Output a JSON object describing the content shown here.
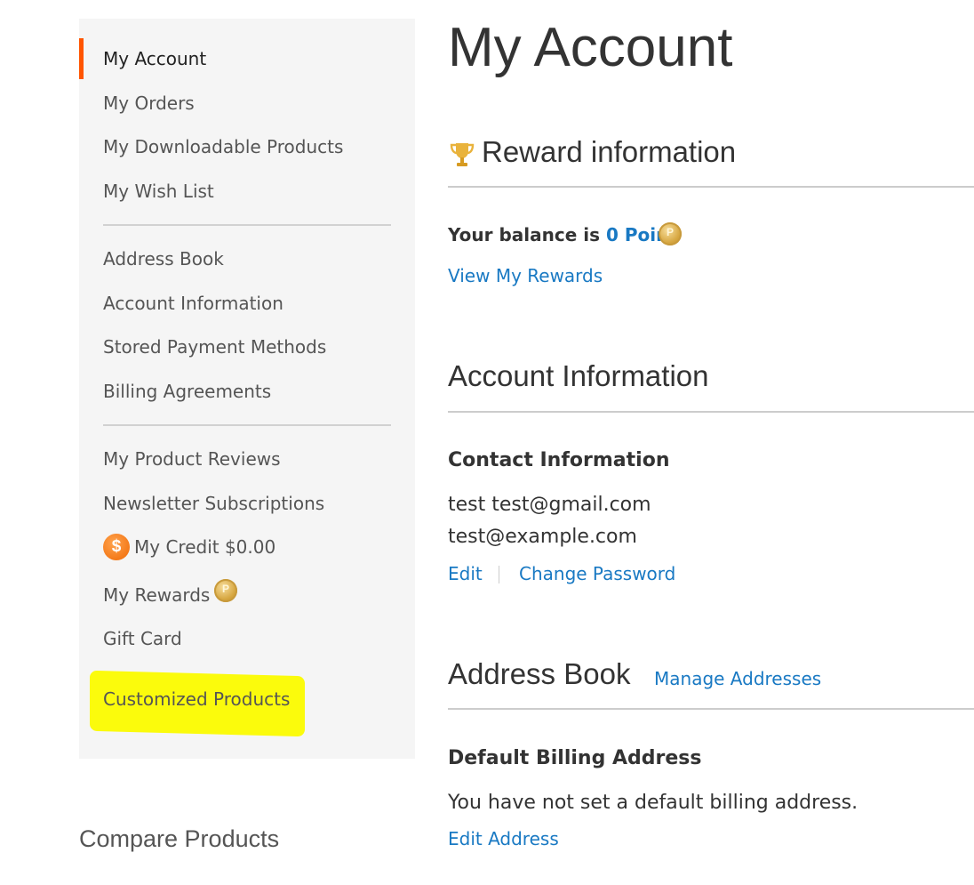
{
  "sidebar": {
    "current": "My Account",
    "group1": [
      "My Orders",
      "My Downloadable Products",
      "My Wish List"
    ],
    "group2": [
      "Address Book",
      "Account Information",
      "Stored Payment Methods",
      "Billing Agreements"
    ],
    "group3": {
      "reviews": "My Product Reviews",
      "newsletter": "Newsletter Subscriptions",
      "credit": "My Credit $0.00",
      "credit_icon": "$",
      "rewards": "My Rewards",
      "gift_card": "Gift Card",
      "customized": "Customized Products"
    },
    "coin_symbol": "P"
  },
  "compare": {
    "title": "Compare Products"
  },
  "main": {
    "page_title": "My Account",
    "reward": {
      "title": "Reward information",
      "balance_prefix": "Your balance is",
      "balance_value": "0 Point",
      "view_link": "View My Rewards"
    },
    "account": {
      "title": "Account Information",
      "contact_title": "Contact Information",
      "name_line": "test test@gmail.com",
      "email": "test@example.com",
      "edit": "Edit",
      "change_password": "Change Password"
    },
    "address": {
      "title": "Address Book",
      "manage": "Manage Addresses",
      "billing_title": "Default Billing Address",
      "billing_text": "You have not set a default billing address.",
      "edit_address": "Edit Address"
    }
  },
  "colors": {
    "accent": "#ff5501",
    "link": "#1979c3",
    "highlight": "#fbfb0c",
    "sidebar_bg": "#f5f5f5"
  },
  "icons": [
    "trophy-icon",
    "credit-icon",
    "reward-coin-icon"
  ]
}
